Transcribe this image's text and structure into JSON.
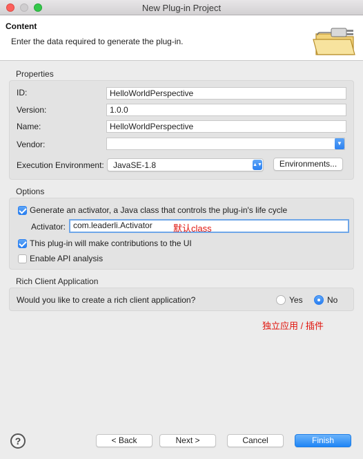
{
  "window": {
    "title": "New Plug-in Project"
  },
  "header": {
    "title": "Content",
    "description": "Enter the data required to generate the plug-in."
  },
  "properties": {
    "group_label": "Properties",
    "id_label": "ID:",
    "id_value": "HelloWorldPerspective",
    "version_label": "Version:",
    "version_value": "1.0.0",
    "name_label": "Name:",
    "name_value": "HelloWorldPerspective",
    "vendor_label": "Vendor:",
    "vendor_value": "",
    "exec_env_label": "Execution Environment:",
    "exec_env_value": "JavaSE-1.8",
    "environments_button": "Environments..."
  },
  "options": {
    "group_label": "Options",
    "generate_activator_label": "Generate an activator, a Java class that controls the plug-in's life cycle",
    "generate_activator_checked": true,
    "activator_label": "Activator:",
    "activator_value": "com.leaderli.Activator",
    "contributions_label": "This plug-in will make contributions to the UI",
    "contributions_checked": true,
    "api_analysis_label": "Enable API analysis",
    "api_analysis_checked": false
  },
  "rcp": {
    "group_label": "Rich Client Application",
    "question": "Would you like to create a rich client application?",
    "yes_label": "Yes",
    "no_label": "No",
    "selected": "No"
  },
  "annotations": {
    "default_class": "默认class",
    "standalone_or_plugin": "独立应用 / 插件",
    "color": "#e0140c"
  },
  "footer": {
    "help_symbol": "?",
    "back_label": "< Back",
    "next_label": "Next >",
    "cancel_label": "Cancel",
    "finish_label": "Finish"
  },
  "icons": {
    "close": "close-icon",
    "minimize": "minimize-icon",
    "maximize": "maximize-icon",
    "wizard": "plugin-folder-icon",
    "combo": "chevron-down-icon",
    "help": "help-icon"
  }
}
